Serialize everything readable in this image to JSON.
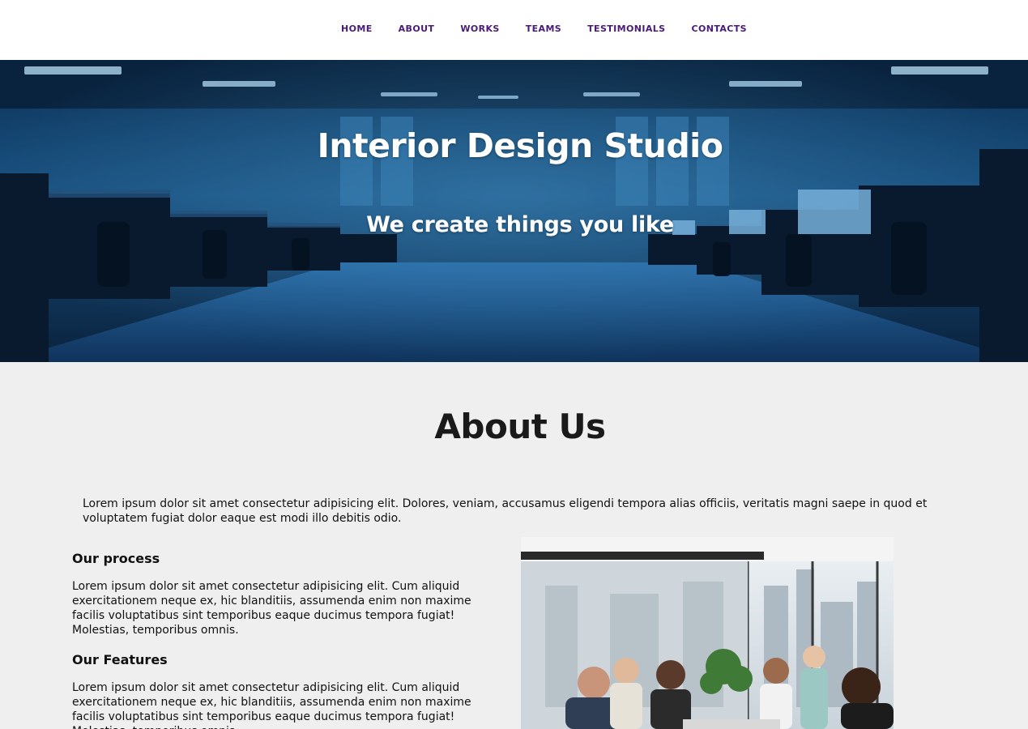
{
  "nav": {
    "items": [
      {
        "label": "HOME"
      },
      {
        "label": "ABOUT"
      },
      {
        "label": "WORKS"
      },
      {
        "label": "TEAMS"
      },
      {
        "label": "TESTIMONIALS"
      },
      {
        "label": "CONTACTS"
      }
    ],
    "color": "#4a1a7a"
  },
  "hero": {
    "title": "Interior Design Studio",
    "subtitle": "We create things you like",
    "background": "office-interior-photo"
  },
  "about": {
    "title": "About Us",
    "intro": "Lorem ipsum dolor sit amet consectetur adipisicing elit. Dolores, veniam, accusamus eligendi tempora alias officiis, veritatis magni saepe in quod et voluptatem fugiat dolor eaque est modi illo debitis odio.",
    "sections": [
      {
        "heading": "Our process",
        "text": "Lorem ipsum dolor sit amet consectetur adipisicing elit. Cum aliquid exercitationem neque ex, hic blanditiis, assumenda enim non maxime facilis voluptatibus sint temporibus eaque ducimus tempora fugiat! Molestias, temporibus omnis."
      },
      {
        "heading": "Our Features",
        "text": "Lorem ipsum dolor sit amet consectetur adipisicing elit. Cum aliquid exercitationem neque ex, hic blanditiis, assumenda enim non maxime facilis voluptatibus sint temporibus eaque ducimus tempora fugiat! Molestias, temporibus omnis."
      }
    ],
    "image": "team-meeting-photo"
  }
}
